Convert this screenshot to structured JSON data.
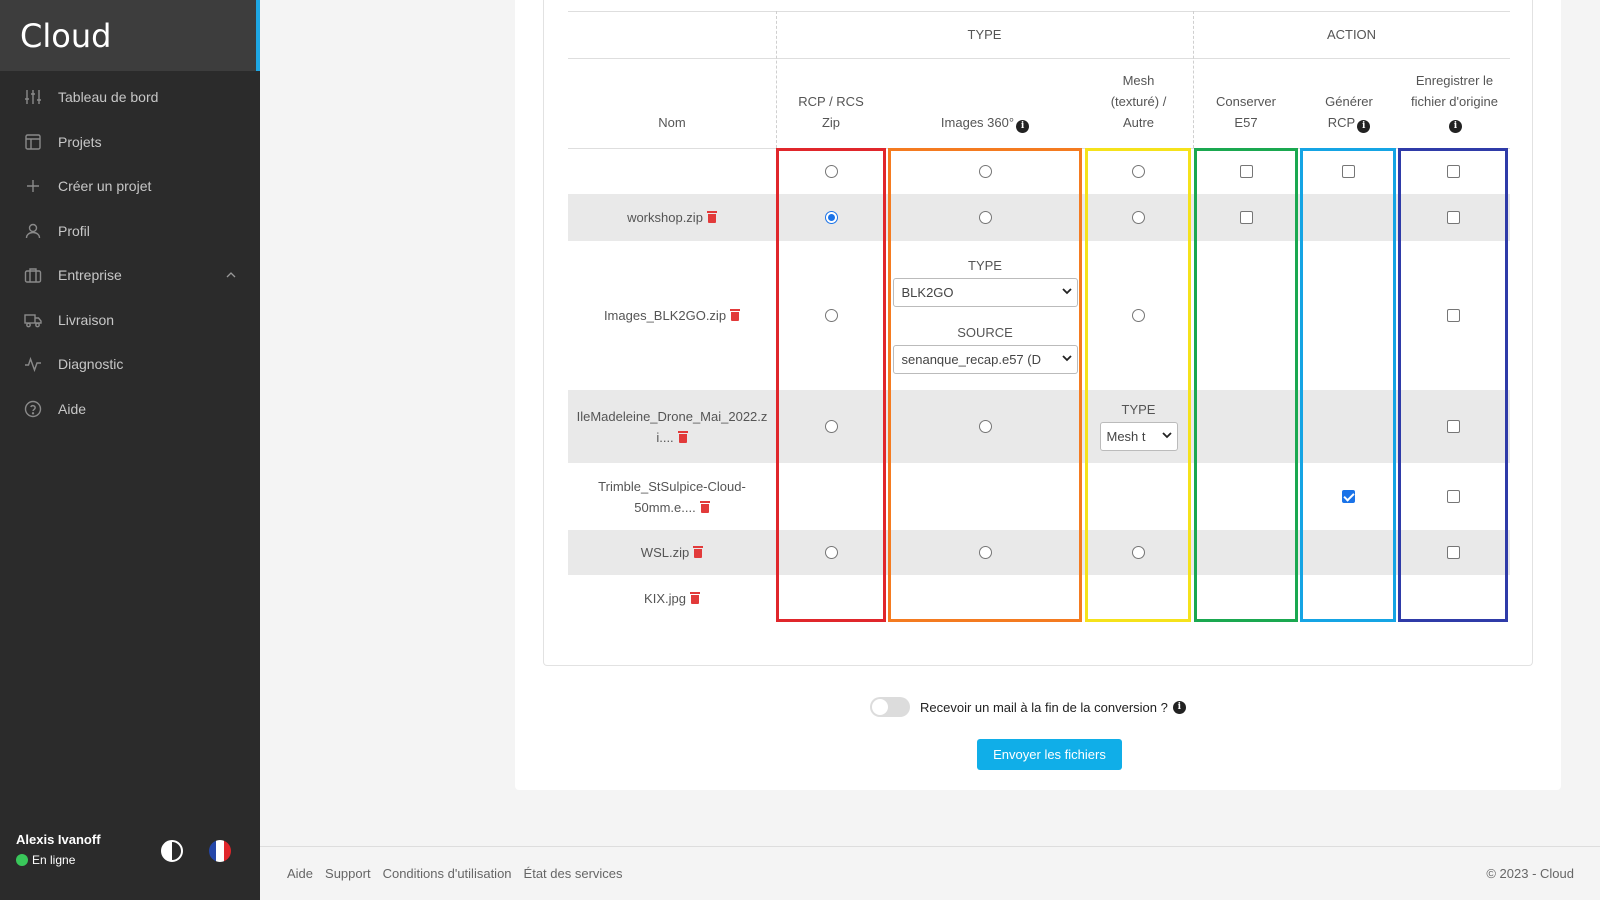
{
  "app": {
    "brand": "Cloud"
  },
  "sidebar": {
    "items": [
      {
        "label": "Tableau de bord",
        "icon": "sliders-icon"
      },
      {
        "label": "Projets",
        "icon": "layout-icon"
      },
      {
        "label": "Créer un projet",
        "icon": "plus-icon"
      },
      {
        "label": "Profil",
        "icon": "user-icon"
      },
      {
        "label": "Entreprise",
        "icon": "briefcase-icon",
        "expanded": true
      },
      {
        "label": "Livraison",
        "icon": "truck-icon"
      },
      {
        "label": "Diagnostic",
        "icon": "activity-icon"
      },
      {
        "label": "Aide",
        "icon": "help-circle-icon"
      }
    ],
    "user": {
      "name": "Alexis Ivanoff",
      "status": "En ligne",
      "status_color": "#39c75a"
    }
  },
  "table": {
    "group_headers": {
      "type": "TYPE",
      "action": "ACTION"
    },
    "columns": {
      "name": "Nom",
      "rcp": "RCP / RCS Zip",
      "images360": "Images 360°",
      "mesh": "Mesh (texturé) / Autre",
      "conserver": "Conserver E57",
      "generer": "Générer RCP",
      "enregistrer": "Enregistrer le fichier d'origine"
    },
    "rows": [
      {
        "name": "workshop.zip",
        "rcp_selected": true,
        "keep_e57": false,
        "save_original": false
      },
      {
        "name": "Images_BLK2GO.zip",
        "images_type_label": "TYPE",
        "images_type_value": "BLK2GO",
        "images_source_label": "SOURCE",
        "images_source_value": "senanque_recap.e57 (D",
        "save_original": false
      },
      {
        "name": "IleMadeleine_Drone_Mai_2022.zi....",
        "mesh_type_label": "TYPE",
        "mesh_type_value": "Mesh t",
        "save_original": false
      },
      {
        "name": "Trimble_StSulpice-Cloud-50mm.e....",
        "generate_rcp": true,
        "save_original": false
      },
      {
        "name": "WSL.zip",
        "save_original": false
      },
      {
        "name": "KIX.jpg"
      }
    ],
    "column_colors": {
      "rcp": "#e0262b",
      "images360": "#f47b20",
      "mesh": "#f5e21b",
      "conserver": "#1aa850",
      "generer": "#15a4e4",
      "enregistrer": "#2f3ba8"
    }
  },
  "notify": {
    "label": "Recevoir un mail à la fin de la conversion ?",
    "enabled": false
  },
  "send_button": "Envoyer les fichiers",
  "footer": {
    "links": [
      "Aide",
      "Support",
      "Conditions d'utilisation",
      "État des services"
    ],
    "copyright": "© 2023 - Cloud"
  }
}
